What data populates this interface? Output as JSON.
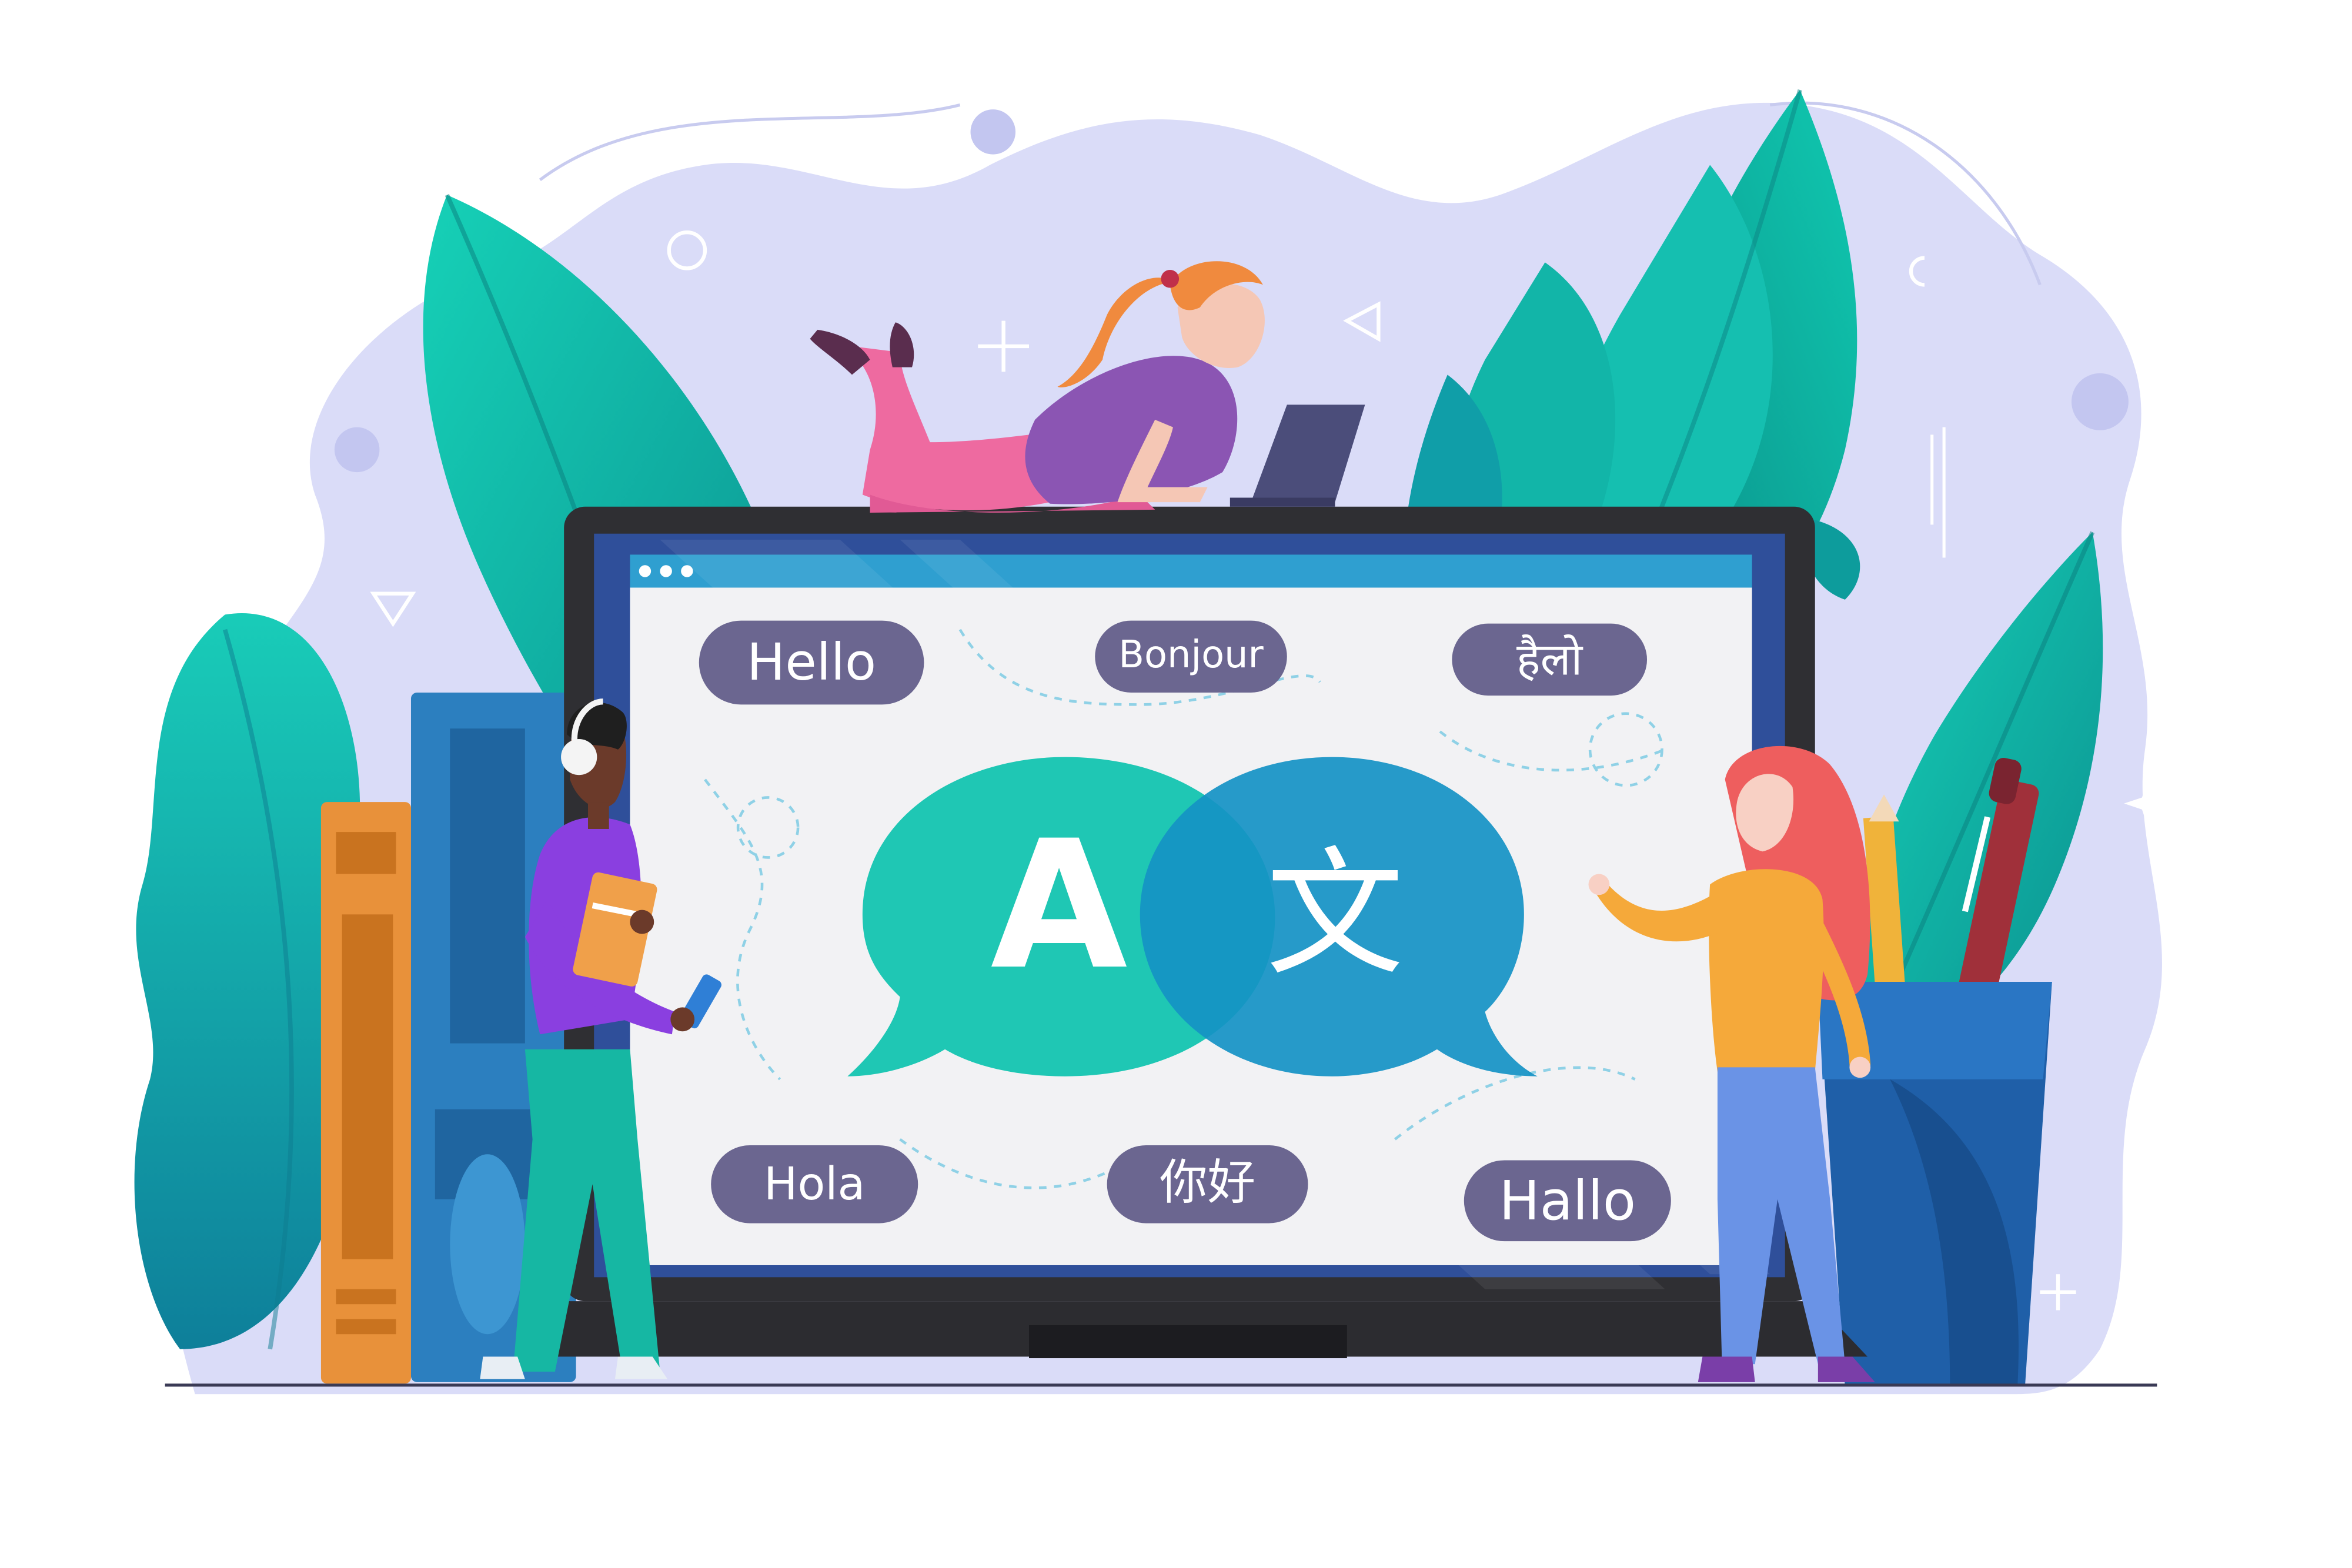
{
  "screen": {
    "dots_icon": "window-dots-icon",
    "bubble_left": {
      "glyph": "A",
      "color": "#1fc7b4",
      "icon": "speech-bubble-icon"
    },
    "bubble_right": {
      "glyph": "文",
      "color": "#1592c4",
      "icon": "speech-bubble-icon"
    },
    "greetings": [
      {
        "text": "Hello"
      },
      {
        "text": "Bonjour"
      },
      {
        "text": "हैलो"
      },
      {
        "text": "Hola"
      },
      {
        "text": "你好"
      },
      {
        "text": "Hallo"
      }
    ]
  },
  "colors": {
    "blob": "#d9dbf7",
    "laptop_frame": "#2f2f33",
    "screen_bg": "#f2f2f4",
    "screen_bar": "#2f9fd0",
    "pill": "#6b6690",
    "leaf_teal": "#11b9a6",
    "leaf_dark": "#0d8c94"
  }
}
